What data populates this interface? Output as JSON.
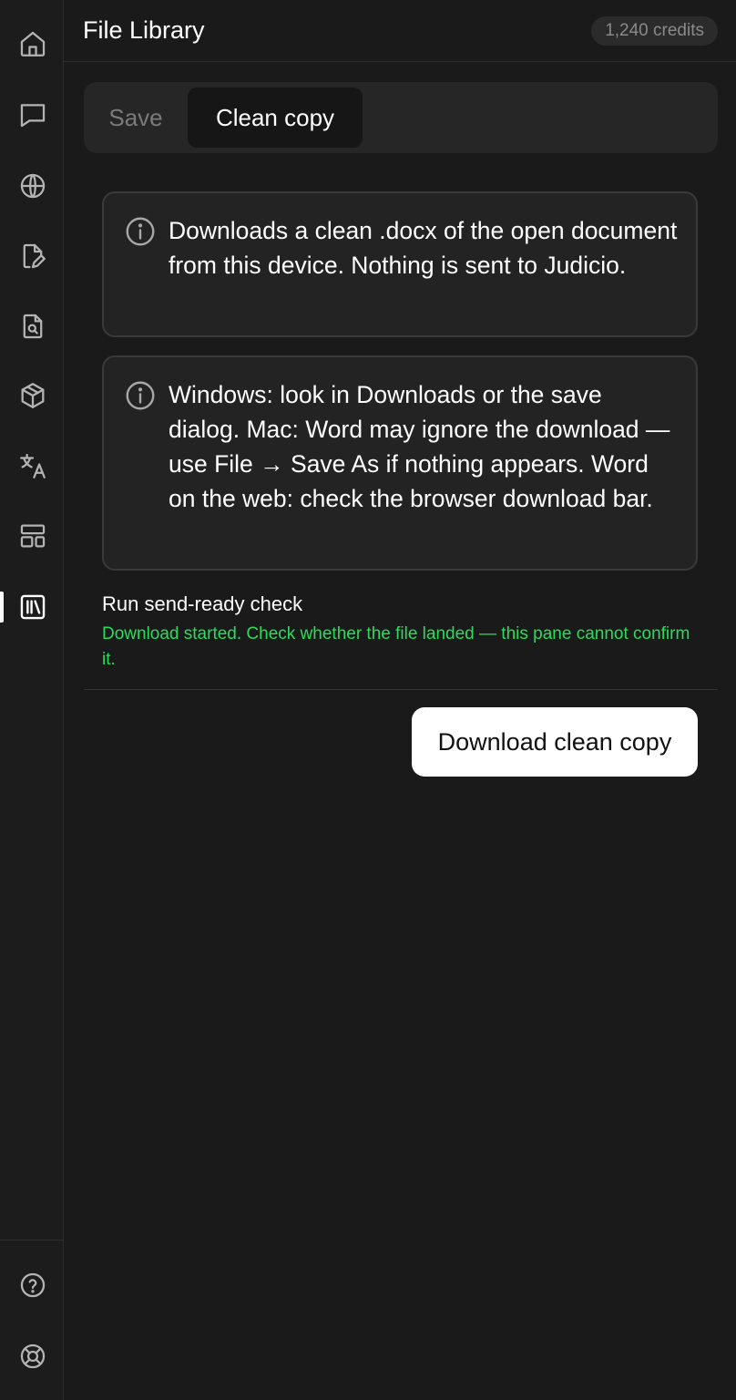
{
  "header": {
    "title": "File Library",
    "credits": "1,240 credits"
  },
  "sidebar": {
    "items": [
      {
        "icon": "home-icon"
      },
      {
        "icon": "chat-icon"
      },
      {
        "icon": "globe-icon"
      },
      {
        "icon": "edit-document-icon"
      },
      {
        "icon": "search-document-icon"
      },
      {
        "icon": "package-icon"
      },
      {
        "icon": "translate-icon"
      },
      {
        "icon": "layout-icon"
      },
      {
        "icon": "library-icon",
        "active": true
      }
    ],
    "bottom_items": [
      {
        "icon": "help-icon"
      },
      {
        "icon": "support-icon"
      }
    ]
  },
  "tabs": [
    {
      "label": "Save",
      "active": false
    },
    {
      "label": "Clean copy",
      "active": true
    }
  ],
  "info_boxes": [
    {
      "text": "Downloads a clean .docx of the open document from this device. Nothing is sent to Judicio."
    },
    {
      "text": "Windows: look in Downloads or the save dialog. Mac: Word may ignore the download — use File → Save As if nothing appears. Word on the web: check the browser download bar."
    }
  ],
  "check": {
    "label": "Run send-ready check",
    "status": "Download started. Check whether the file landed — this pane cannot confirm it."
  },
  "actions": {
    "download_label": "Download clean copy"
  },
  "colors": {
    "background": "#1a1a1a",
    "status_green": "#2bdc5c",
    "primary_button": "#ffffff"
  }
}
